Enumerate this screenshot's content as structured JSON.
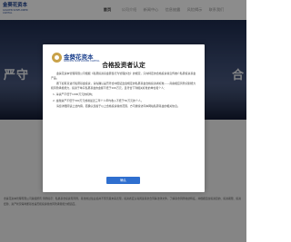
{
  "header": {
    "logo_cn": "金葵花资本",
    "logo_en": "GOLDEN SUNFLOWER CAPITAL",
    "nav": [
      "首页",
      "公司介绍",
      "新闻中心",
      "信息披露",
      "风险揭示",
      "联系我们"
    ],
    "active_nav": "首页"
  },
  "hero": {
    "text_left": "严守",
    "text_right": "合"
  },
  "modal": {
    "logo_cn": "金葵花资本",
    "logo_en": "GOLDEN SUNFLOWER CAPITAL",
    "title": "合格投资者认定",
    "paragraphs": [
      "金葵花资本管理有限公司根据《私募投资基金募集行为管理办法》的规定，只向特定的合格投资者宣传推介私募投资基金产品。",
      "阁下如有意进行私募基金投资，请先确认是否符合中国证监会规定的私募基金合格投资者标准——具备相应风险识别能力和风险承担能力，投资于单只私募基金的金额不低于100万元，且符合下列相关标准的单位和个人："
    ],
    "items": [
      "1. 净资产不低于1000万元的机构；",
      "2. 金融资产不低于300万元或者最近三年个人年均收入不低于50万元的个人。"
    ],
    "closing": "请您详细阅读上述内容，若确认您属于以上合格投资者的范围，方可继续访问本网站私募基金的相关信息。",
    "confirm_label": "确认"
  },
  "footer": {
    "text": "金葵花资本管理有限公司版权所有 风险提示：私募基金投资有风险，基金的过往业绩并不预示其未来表现，投资者应认真阅读基金合同等法律文件，了解基金风险收益特征，并根据自身投资目的、投资期限、投资经验、资产状况等判断基金是否和投资者的风险承受能力相适应。"
  }
}
